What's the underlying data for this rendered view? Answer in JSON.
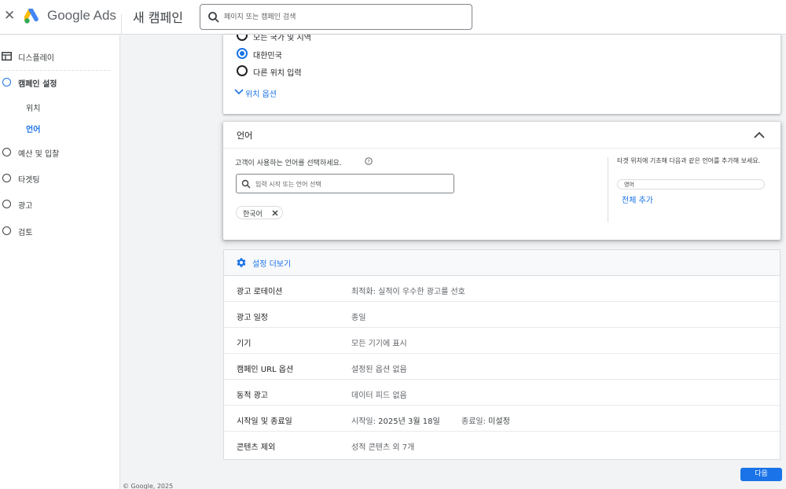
{
  "header": {
    "brand": "Google Ads",
    "page_title": "새 캠페인",
    "search_placeholder": "페이지 또는 캠페인 검색"
  },
  "sidebar": {
    "display_label": "디스플레이",
    "items": [
      {
        "label": "캠페인 설정"
      },
      {
        "label": "예산 및 입찰"
      },
      {
        "label": "타겟팅"
      },
      {
        "label": "광고"
      },
      {
        "label": "검토"
      }
    ],
    "sub_items": [
      {
        "label": "위치"
      },
      {
        "label": "언어"
      }
    ],
    "copyright": "© Google, 2025"
  },
  "location": {
    "options": [
      {
        "label": "모든 국가 및 지역",
        "selected": false
      },
      {
        "label": "대한민국",
        "selected": true
      },
      {
        "label": "다른 위치 입력",
        "selected": false
      }
    ],
    "more_options": "위치 옵션"
  },
  "language": {
    "title": "언어",
    "question": "고객이 사용하는 언어를 선택하세요.",
    "input_placeholder": "입력 시작 또는 언어 선택",
    "selected_chip": "한국어",
    "suggest_text": "타겟 위치에 기초해 다음과 같은 언어를 추가해 보세요.",
    "suggest_chip": "영어",
    "add_all": "전체 추가"
  },
  "more_settings": {
    "title": "설정 더보기",
    "rows": [
      {
        "key": "광고 로테이션",
        "value": "최적화: 실적이 우수한 광고를 선호"
      },
      {
        "key": "광고 일정",
        "value": "종일"
      },
      {
        "key": "기기",
        "value": "모든 기기에 표시"
      },
      {
        "key": "캠페인 URL 옵션",
        "value": "설정된 옵션 없음"
      },
      {
        "key": "동적 광고",
        "value": "데이터 피드 없음"
      },
      {
        "key": "시작일 및 종료일",
        "start_label": "시작일:",
        "start_value": "2025년 3월 18일",
        "end_label": "종료일:",
        "end_value": "미설정"
      },
      {
        "key": "콘텐츠 제외",
        "value": "성적 콘텐츠 외 7개"
      }
    ]
  },
  "footer": {
    "next_button": "다음"
  }
}
